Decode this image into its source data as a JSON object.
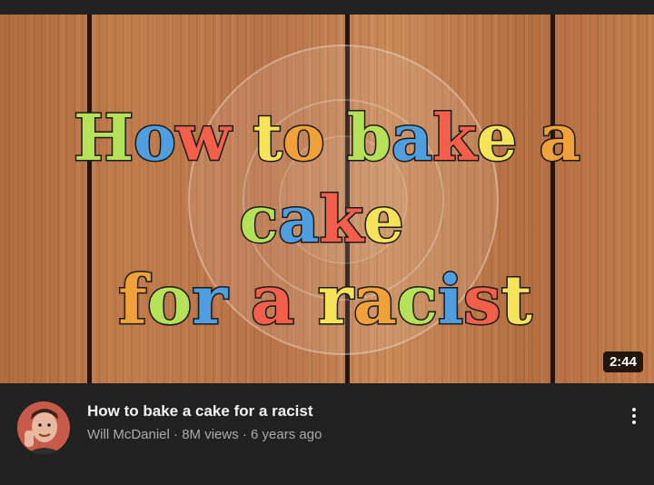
{
  "thumbnail": {
    "art_lines": [
      "How to bake a",
      "cake",
      "for a racist"
    ],
    "duration": "2:44",
    "letter_colors": [
      "#b6e25a",
      "#4f9fe0",
      "#f2604b",
      "#f5e35a",
      "#f1a13a"
    ]
  },
  "video": {
    "title": "How to bake a cake for a racist",
    "channel": "Will McDaniel",
    "views": "8M views",
    "age": "6 years ago",
    "separator": "·"
  },
  "icons": {
    "avatar": "avatar",
    "more": "more-vert-icon"
  }
}
